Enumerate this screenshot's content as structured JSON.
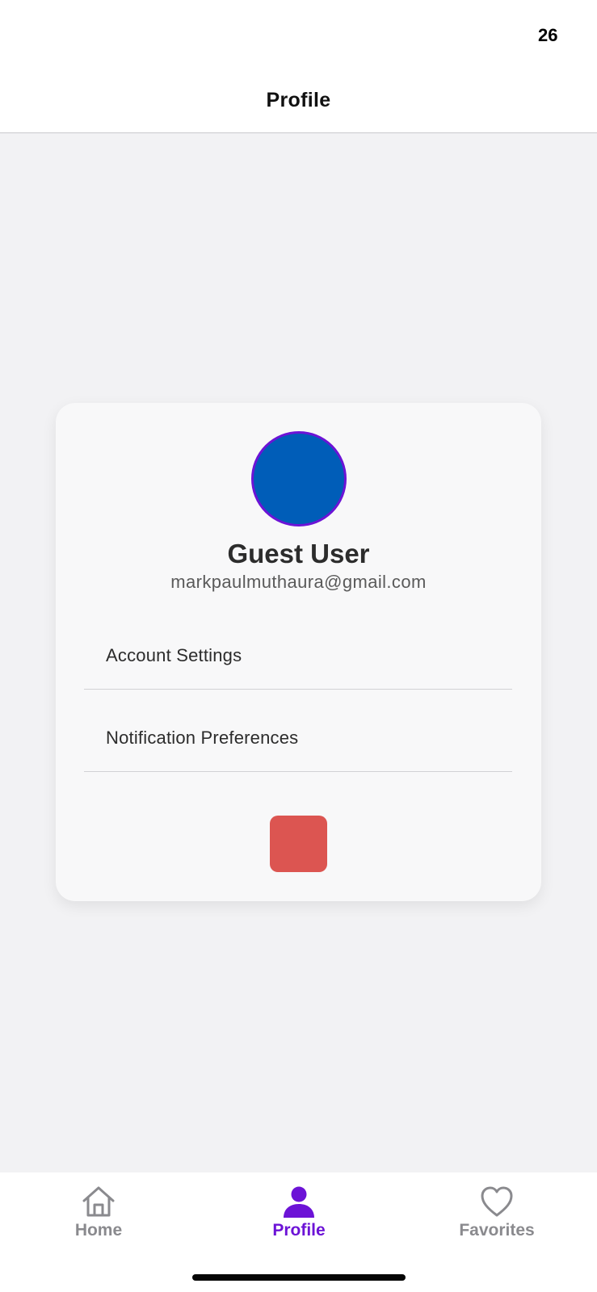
{
  "status_bar": {
    "battery_level": "26",
    "battery_color": "#f5cc1a"
  },
  "header": {
    "title": "Profile"
  },
  "profile": {
    "avatar_color": "#005db8",
    "avatar_border_color": "#6c13d6",
    "name": "Guest User",
    "email": "markpaulmuthaura@gmail.com"
  },
  "menu": {
    "items": [
      {
        "label": "Account Settings"
      },
      {
        "label": "Notification Preferences"
      }
    ]
  },
  "logout_button": {
    "color": "#dc5551"
  },
  "tab_bar": {
    "active_color": "#6c13d6",
    "inactive_color": "#8a8a8e",
    "tabs": [
      {
        "label": "Home",
        "icon": "home-icon"
      },
      {
        "label": "Profile",
        "icon": "person-icon"
      },
      {
        "label": "Favorites",
        "icon": "heart-icon"
      }
    ]
  }
}
